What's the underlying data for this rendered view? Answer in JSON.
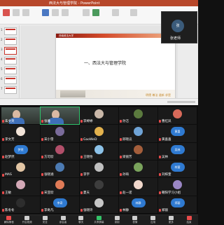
{
  "app": {
    "window_title": "西法大与管理学院 - PowerPoint"
  },
  "slide": {
    "school_logo": "西南政法大学",
    "title": "一、西法大与管理学院",
    "motto": "明德 尊法 道新 求是"
  },
  "self_view": {
    "name": "张老师",
    "avatar_text": "张"
  },
  "participants": [
    {
      "name": "朱文英",
      "type": "camera"
    },
    {
      "name": "张雅",
      "type": "camera"
    },
    {
      "name": "李婷婷",
      "type": "avatar",
      "color": "#c9b7a8"
    },
    {
      "name": "孙洁",
      "type": "avatar",
      "color": "#5b7a3e"
    },
    {
      "name": "曹红凤",
      "type": "avatar",
      "color": "#d86a5a"
    },
    {
      "name": "李文芳",
      "type": "avatar",
      "color": "#f2e3d8"
    },
    {
      "name": "宋小雪",
      "type": "avatar",
      "color": "#7a6b9a"
    },
    {
      "name": "GaoWeD",
      "type": "avatar",
      "color": "#e3b24d"
    },
    {
      "name": "邱晓瓜",
      "type": "avatar",
      "color": "#6fa3d6"
    },
    {
      "name": "黄喜喜",
      "type": "pill",
      "color": "#2f7ad1",
      "text": "黄喜"
    },
    {
      "name": "赵梦然",
      "type": "pill",
      "color": "#2f7ad1",
      "text": "梦然"
    },
    {
      "name": "方可欣",
      "type": "avatar",
      "color": "#b24f6a"
    },
    {
      "name": "王晓怡",
      "type": "avatar",
      "color": "#8cc2e8"
    },
    {
      "name": "梁丽芳",
      "type": "avatar",
      "color": "#a45e3b"
    },
    {
      "name": "吴林",
      "type": "pill",
      "color": "#2f7ad1",
      "text": "吴林"
    },
    {
      "name": "MAS",
      "type": "avatar",
      "color": "#e2c5a4"
    },
    {
      "name": "张晓涵",
      "type": "avatar",
      "color": "#4c7bb3"
    },
    {
      "name": "李宇",
      "type": "avatar",
      "color": "#c0c0c0"
    },
    {
      "name": "孙琦",
      "type": "avatar",
      "color": "#7aa35c"
    },
    {
      "name": "刘梓萱",
      "type": "pill",
      "color": "#2f7ad1",
      "text": "梓萱"
    },
    {
      "name": "王敏",
      "type": "avatar",
      "color": "#d3a8b6"
    },
    {
      "name": "宋亚欣",
      "type": "avatar",
      "color": "#e07b57"
    },
    {
      "name": "夏天",
      "type": "avatar",
      "color": "#3d3d3d"
    },
    {
      "name": "赵一诺",
      "type": "avatar",
      "color": "#f0d7cb"
    },
    {
      "name": "朝阳学习小组",
      "type": "avatar",
      "color": "#9a86c4"
    },
    {
      "name": "陈冬冬",
      "type": "avatar",
      "color": "#2d2d2d"
    },
    {
      "name": "李奇凡",
      "type": "pill",
      "color": "#2f7ad1",
      "text": "李奇"
    },
    {
      "name": "张晓玲",
      "type": "avatar",
      "color": "#c7c7c7"
    },
    {
      "name": "林静",
      "type": "pill",
      "color": "#2f7ad1",
      "text": "林静"
    },
    {
      "name": "郑丽",
      "type": "pill",
      "color": "#2f7ad1",
      "text": "郑丽"
    }
  ],
  "toolbar": {
    "items": [
      {
        "label": "解除静音",
        "icon": "mic-muted-icon",
        "color": "red"
      },
      {
        "label": "开启视频",
        "icon": "video-icon",
        "color": "gray"
      },
      {
        "label": "安全",
        "icon": "shield-icon",
        "color": "gray"
      },
      {
        "label": "参会者",
        "icon": "participants-icon",
        "color": "gray"
      },
      {
        "label": "聊天",
        "icon": "chat-icon",
        "color": "gray"
      },
      {
        "label": "共享屏幕",
        "icon": "share-screen-icon",
        "color": "green"
      },
      {
        "label": "录制",
        "icon": "record-icon",
        "color": "gray"
      },
      {
        "label": "表情",
        "icon": "reaction-icon",
        "color": "gray"
      },
      {
        "label": "应用",
        "icon": "apps-icon",
        "color": "gray"
      },
      {
        "label": "更多",
        "icon": "more-icon",
        "color": "gray"
      },
      {
        "label": "结束",
        "icon": "end-call-icon",
        "color": "red"
      }
    ]
  }
}
